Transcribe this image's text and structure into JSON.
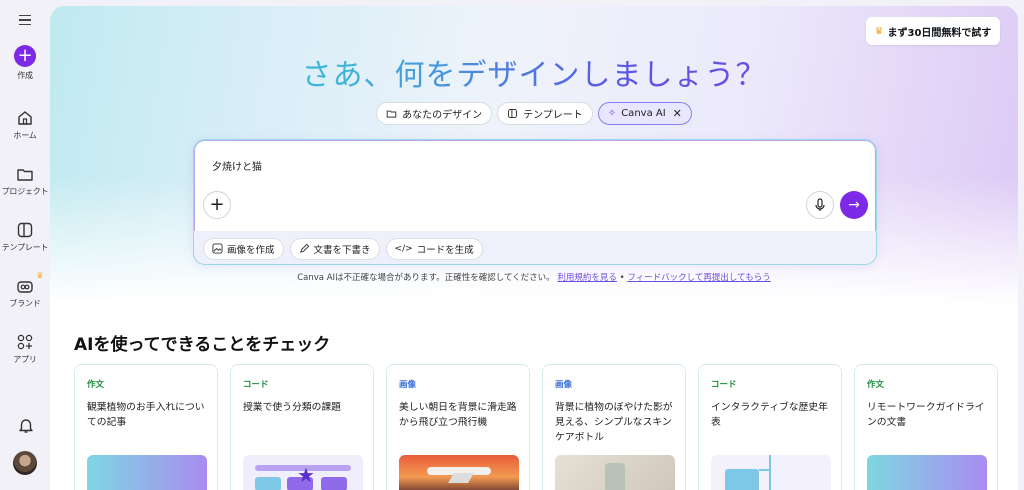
{
  "sidebar": {
    "create_label": "作成",
    "items": [
      {
        "label": "ホーム",
        "icon": "home-icon"
      },
      {
        "label": "プロジェクト",
        "icon": "folder-icon"
      },
      {
        "label": "テンプレート",
        "icon": "template-icon"
      },
      {
        "label": "ブランド",
        "icon": "brand-icon"
      },
      {
        "label": "アプリ",
        "icon": "apps-icon"
      }
    ]
  },
  "header": {
    "trial_button": "まず30日間無料で試す",
    "title": "さあ、何をデザインしましょう？"
  },
  "pills": [
    {
      "label": "あなたのデザイン",
      "icon": "folder-icon"
    },
    {
      "label": "テンプレート",
      "icon": "template-icon"
    },
    {
      "label": "Canva AI",
      "icon": "sparkle-icon",
      "active": true
    }
  ],
  "prompt": {
    "value": "夕焼けと猫",
    "tools": [
      {
        "label": "画像を作成",
        "icon": "image-icon"
      },
      {
        "label": "文書を下書き",
        "icon": "pen-icon"
      },
      {
        "label": "コードを生成",
        "icon": "code-icon"
      }
    ]
  },
  "disclaimer": {
    "text": "Canva AIは不正確な場合があります。正確性を確認してください。",
    "link1": "利用規約を見る",
    "separator": "•",
    "link2": "フィードバックして再提出してもらう"
  },
  "section": {
    "title": "AIを使ってできることをチェック",
    "cards": [
      {
        "tag": "作文",
        "desc": "観葉植物のお手入れについての記事"
      },
      {
        "tag": "コード",
        "desc": "授業で使う分類の課題"
      },
      {
        "tag": "画像",
        "desc": "美しい朝日を背景に滑走路から飛び立つ飛行機"
      },
      {
        "tag": "画像",
        "desc": "背景に植物のぼやけた影が見える、シンプルなスキンケアボトル"
      },
      {
        "tag": "コード",
        "desc": "インタラクティブな歴史年表"
      },
      {
        "tag": "作文",
        "desc": "リモートワークガイドラインの文書"
      }
    ]
  },
  "colors": {
    "accent": "#7d2ae8",
    "tag_writing": "#1a8a3a",
    "tag_image": "#3b6fd8"
  }
}
